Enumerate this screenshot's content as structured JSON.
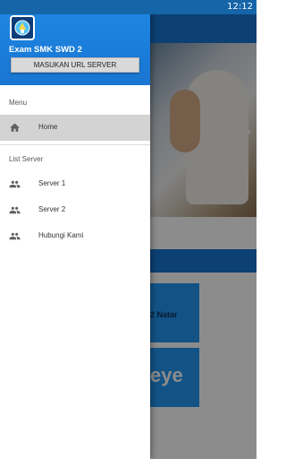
{
  "status_bar": {
    "time": "12:12"
  },
  "drawer": {
    "app_title": "Exam SMK SWD 2",
    "server_button_label": "MASUKAN URL SERVER",
    "menu_section_label": "Menu",
    "menu_items": [
      {
        "label": "Home",
        "icon": "home-icon",
        "active": true
      }
    ],
    "server_section_label": "List Server",
    "server_items": [
      {
        "label": "Server 1",
        "icon": "people-icon"
      },
      {
        "label": "Server 2",
        "icon": "people-icon"
      },
      {
        "label": "Hubungi Kami",
        "icon": "people-icon"
      }
    ]
  },
  "background": {
    "card1_text": "2 Natar",
    "card2_text": "eye"
  },
  "colors": {
    "primary": "#1976d2",
    "status_bar": "#1565a8",
    "active_item": "#d3d3d3"
  }
}
